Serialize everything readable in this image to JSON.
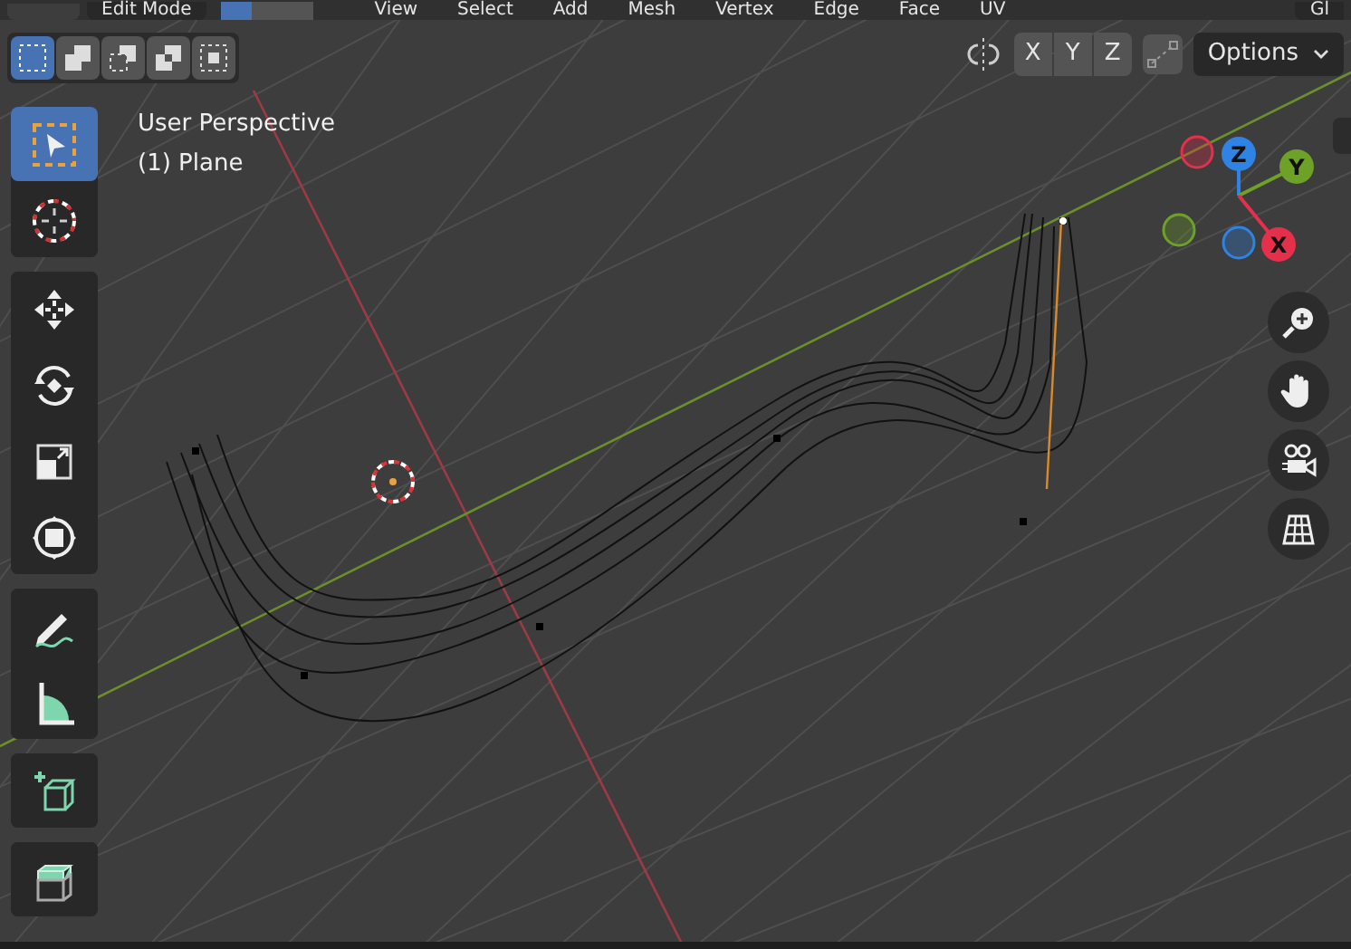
{
  "header": {
    "mode": "Edit Mode",
    "select_modes": [
      {
        "selected": true
      },
      {
        "selected": false
      },
      {
        "selected": false
      }
    ],
    "menus": [
      "View",
      "Select",
      "Add",
      "Mesh",
      "Vertex",
      "Edge",
      "Face",
      "UV"
    ],
    "cut_item": "Gl"
  },
  "tool_header": {
    "selection_modes": [
      {
        "kind": "new",
        "selected": true
      },
      {
        "kind": "extend",
        "selected": false
      },
      {
        "kind": "subtract",
        "selected": false
      },
      {
        "kind": "difference",
        "selected": false
      },
      {
        "kind": "intersect",
        "selected": false
      }
    ],
    "mirror_axes": [
      {
        "label": "X",
        "selected": false
      },
      {
        "label": "Y",
        "selected": false
      },
      {
        "label": "Z",
        "selected": false
      }
    ],
    "options": "Options"
  },
  "tool_groups": [
    {
      "tools": [
        {
          "kind": "select_box",
          "selected": true
        },
        {
          "kind": "cursor",
          "selected": false
        }
      ]
    },
    {
      "tools": [
        {
          "kind": "move",
          "selected": false
        },
        {
          "kind": "rotate",
          "selected": false
        },
        {
          "kind": "scale",
          "selected": false
        },
        {
          "kind": "transform",
          "selected": false
        }
      ]
    },
    {
      "tools": [
        {
          "kind": "annotate",
          "selected": false
        },
        {
          "kind": "measure",
          "selected": false
        }
      ]
    },
    {
      "tools": [
        {
          "kind": "add_cube",
          "selected": false
        }
      ]
    },
    {
      "tools": [
        {
          "kind": "extrude",
          "selected": false
        }
      ]
    }
  ],
  "viewport": {
    "overlay_lines": [
      "User Perspective",
      "(1) Plane"
    ],
    "gizmo_axes": [
      {
        "label": "Z",
        "color": "#2f83e4"
      },
      {
        "label": "Y",
        "color": "#6ea128"
      },
      {
        "label": "X",
        "color": "#e5304c"
      }
    ],
    "nav_buttons": [
      {
        "kind": "zoom"
      },
      {
        "kind": "pan"
      },
      {
        "kind": "camera"
      },
      {
        "kind": "ortho"
      }
    ]
  }
}
